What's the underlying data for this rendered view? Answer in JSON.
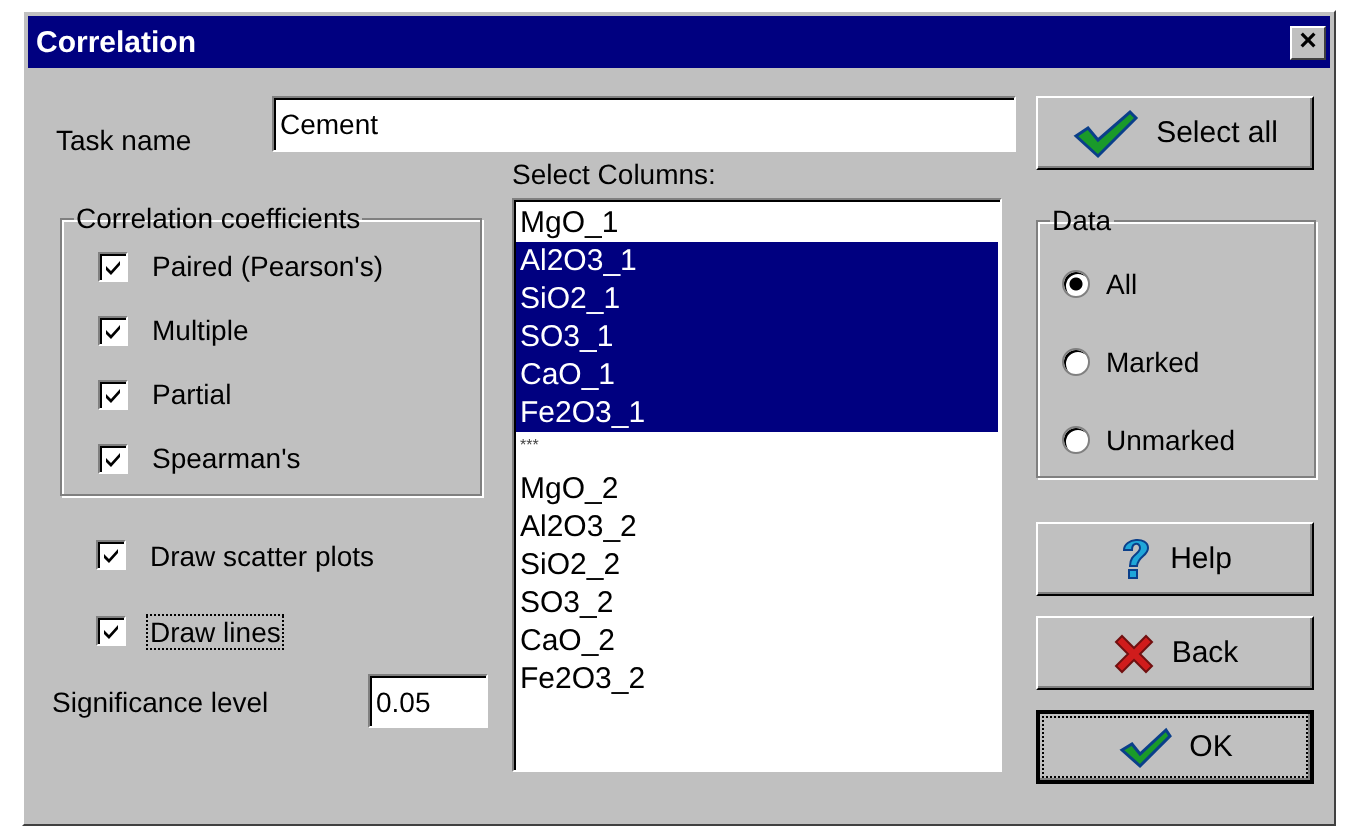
{
  "window": {
    "title": "Correlation",
    "close": "×"
  },
  "task_name": {
    "label": "Task name",
    "value": "Cement"
  },
  "coefficients": {
    "title": "Correlation coefficients",
    "items": [
      {
        "label": "Paired (Pearson's)",
        "checked": true
      },
      {
        "label": "Multiple",
        "checked": true
      },
      {
        "label": "Partial",
        "checked": true
      },
      {
        "label": "Spearman's",
        "checked": true
      }
    ]
  },
  "options": [
    {
      "label": "Draw scatter plots",
      "checked": true,
      "focused": false
    },
    {
      "label": "Draw lines",
      "checked": true,
      "focused": true
    }
  ],
  "significance": {
    "label": "Significance level",
    "value": "0.05"
  },
  "columns": {
    "label": "Select Columns:",
    "items": [
      {
        "label": "MgO_1",
        "selected": false
      },
      {
        "label": "Al2O3_1",
        "selected": true
      },
      {
        "label": "SiO2_1",
        "selected": true
      },
      {
        "label": "SO3_1",
        "selected": true
      },
      {
        "label": "CaO_1",
        "selected": true
      },
      {
        "label": "Fe2O3_1",
        "selected": true
      },
      {
        "label": "***",
        "selected": false
      },
      {
        "label": "MgO_2",
        "selected": false
      },
      {
        "label": "Al2O3_2",
        "selected": false
      },
      {
        "label": "SiO2_2",
        "selected": false
      },
      {
        "label": "SO3_2",
        "selected": false
      },
      {
        "label": "CaO_2",
        "selected": false
      },
      {
        "label": "Fe2O3_2",
        "selected": false
      }
    ]
  },
  "data": {
    "title": "Data",
    "options": [
      {
        "label": "All",
        "selected": true
      },
      {
        "label": "Marked",
        "selected": false
      },
      {
        "label": "Unmarked",
        "selected": false
      }
    ]
  },
  "buttons": [
    {
      "label": "Select all",
      "kind": "select"
    },
    {
      "label": "Help",
      "kind": "help"
    },
    {
      "label": "Back",
      "kind": "back"
    },
    {
      "label": "OK",
      "kind": "ok"
    }
  ]
}
